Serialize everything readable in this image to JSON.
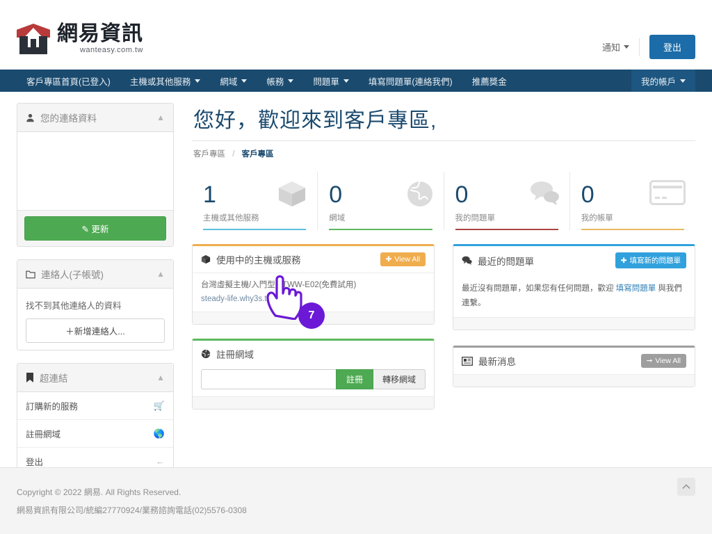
{
  "header": {
    "logo_cn": "網易資訊",
    "logo_en": "wanteasy.com.tw",
    "notify_label": "通知",
    "logout_label": "登出"
  },
  "navbar": {
    "items": [
      {
        "label": "客戶專區首頁(已登入)",
        "caret": false
      },
      {
        "label": "主機或其他服務",
        "caret": true
      },
      {
        "label": "網域",
        "caret": true
      },
      {
        "label": "帳務",
        "caret": true
      },
      {
        "label": "問題單",
        "caret": true
      },
      {
        "label": "填寫問題單(連絡我們)",
        "caret": false
      },
      {
        "label": "推薦獎金",
        "caret": false
      }
    ],
    "account": {
      "label": "我的帳戶",
      "caret": true
    }
  },
  "sidebar": {
    "contact_panel": {
      "icon": "user-icon",
      "title": "您的連絡資料",
      "update_label": "更新"
    },
    "subaccount_panel": {
      "icon": "folder-icon",
      "title": "連絡人(子帳號)",
      "empty_text": "找不到其他連絡人的資料",
      "add_label": "＋新增連絡人..."
    },
    "links_panel": {
      "icon": "bookmark-icon",
      "title": "超連結",
      "items": [
        {
          "label": "訂購新的服務",
          "icon": "cart-icon"
        },
        {
          "label": "註冊網域",
          "icon": "globe-icon"
        },
        {
          "label": "登出",
          "icon": "arrow-left-icon"
        }
      ]
    }
  },
  "main": {
    "page_title": "您好，歡迎來到客戶專區,",
    "breadcrumb": {
      "parent": "客戶專區",
      "separator": "/",
      "current": "客戶專區"
    },
    "stats": [
      {
        "value": "1",
        "label": "主機或其他服務",
        "icon": "box-icon",
        "color": "#5bc0de"
      },
      {
        "value": "0",
        "label": "網域",
        "icon": "globe-icon",
        "color": "#5cb85c"
      },
      {
        "value": "0",
        "label": "我的問題單",
        "icon": "chat-icon",
        "color": "#a94442"
      },
      {
        "value": "0",
        "label": "我的帳單",
        "icon": "creditcard-icon",
        "color": "#e8b960"
      }
    ],
    "services_widget": {
      "icon": "box-icon",
      "title": "使用中的主機或服務",
      "action_label": "View All",
      "action_icon": "plus-icon",
      "accent": "#f0ad4e",
      "items": [
        {
          "name": "台灣虛擬主機/入門型 - TWW-E02(免費試用)",
          "domain": "steady-life.why3s.tw"
        }
      ]
    },
    "domain_widget": {
      "icon": "globe-icon",
      "title": "註冊網域",
      "accent": "#5cb85c",
      "input_value": "",
      "input_placeholder": "",
      "register_label": "註冊",
      "transfer_label": "轉移網域"
    },
    "tickets_widget": {
      "icon": "chat-icon",
      "title": "最近的問題單",
      "action_label": "填寫新的問題單",
      "action_icon": "plus-icon",
      "accent": "#31a1dd",
      "body_prefix": "最近沒有問題單，如果您有任何問題，歡迎 ",
      "body_link": "填寫問題單",
      "body_suffix": " 與我們連繫。"
    },
    "news_widget": {
      "icon": "news-icon",
      "title": "最新消息",
      "action_label": "View All",
      "action_icon": "arrow-right-icon",
      "accent": "#9e9e9e"
    }
  },
  "footer": {
    "copyright": "Copyright © 2022 網易. All Rights Reserved.",
    "company": "網易資訊有限公司/統編27770924/業務諮詢電話(02)5576-0308",
    "scroll_top_icon": "chevron-up-icon"
  },
  "annotation": {
    "step_number": "7",
    "cursor_icon": "pointing-hand-cursor",
    "color": "#6b19d6"
  }
}
